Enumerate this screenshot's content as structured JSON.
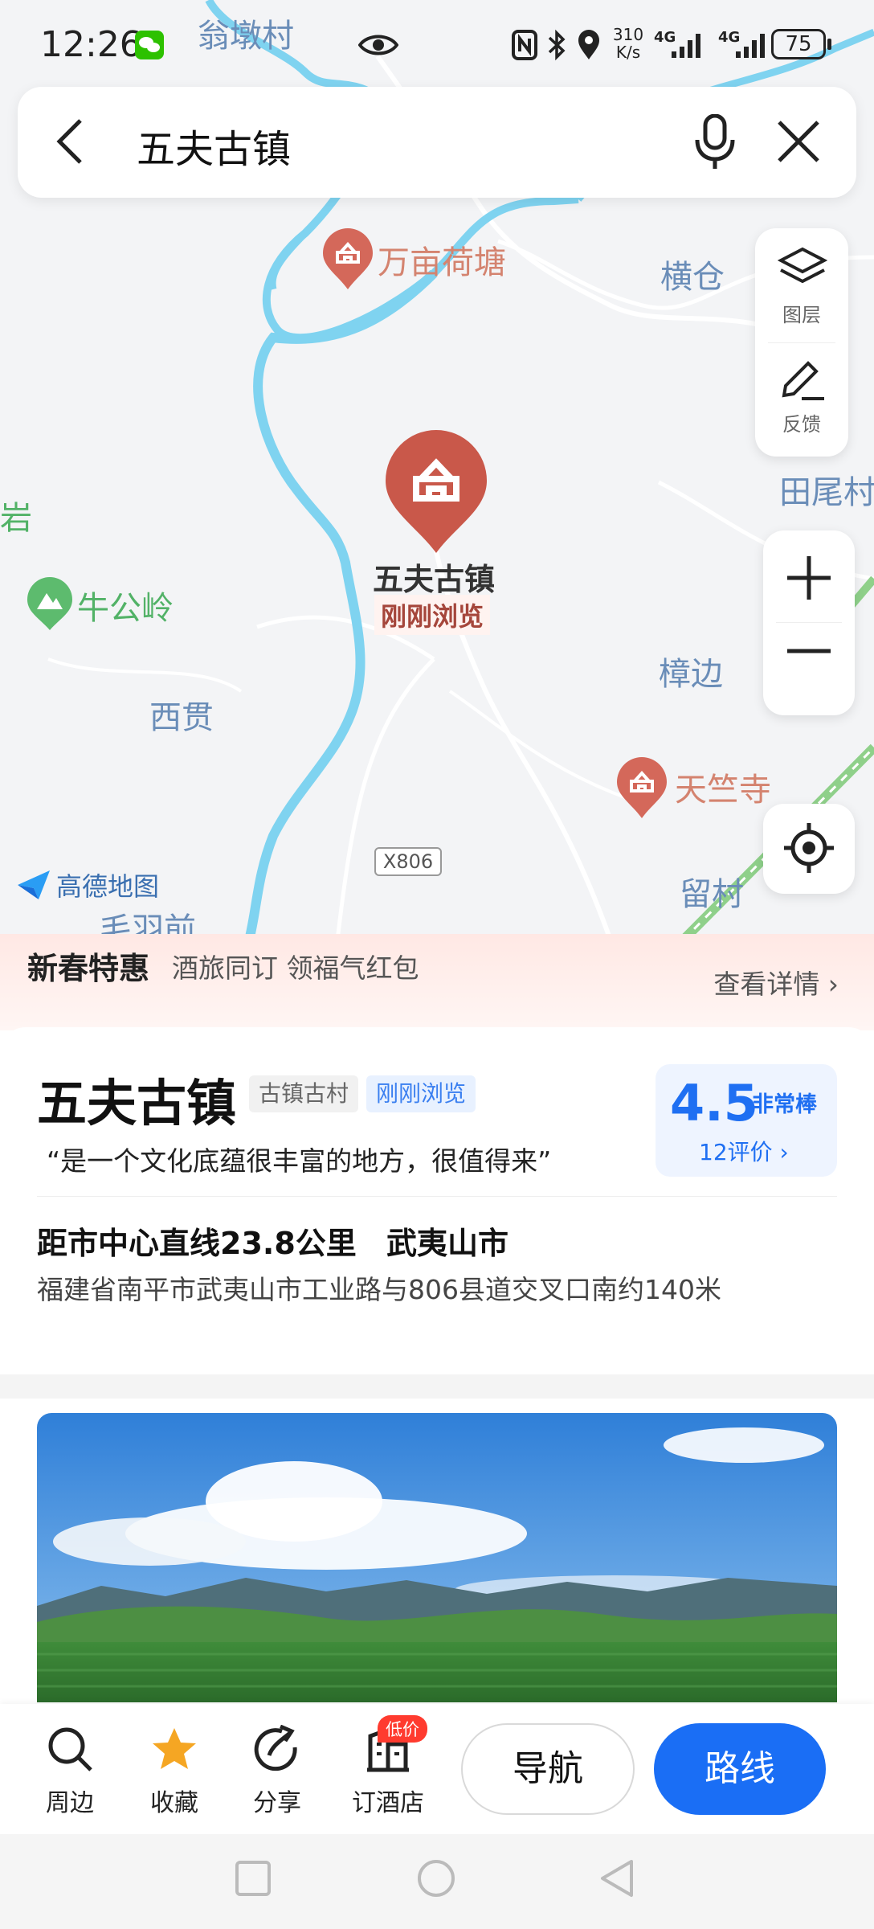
{
  "status_bar": {
    "time": "12:26",
    "net_speed_top": "310",
    "net_speed_bottom": "K/s",
    "network_1": "4G",
    "network_2": "4G",
    "battery": "75"
  },
  "search": {
    "query": "五夫古镇"
  },
  "map": {
    "labels": {
      "wengdun": "翁墩村",
      "wanmu": "万亩荷塘",
      "hengcang": "横仓",
      "tianwei": "田尾村",
      "yan": "岩",
      "niugongling": "牛公岭",
      "zhangbian": "樟边",
      "xigui": "西贯",
      "tianzhu": "天竺寺",
      "road": "X806",
      "liucun": "留村",
      "maoyu": "毛羽前"
    },
    "selected_poi": {
      "name": "五夫古镇",
      "badge": "刚刚浏览"
    },
    "logo": "高德地图",
    "controls": {
      "layers": "图层",
      "feedback": "反馈"
    }
  },
  "promo": {
    "title": "新春特惠",
    "subtitle": "酒旅同订 领福气红包",
    "more": "查看详情 ›"
  },
  "place": {
    "name": "五夫古镇",
    "tag_category": "古镇古村",
    "tag_recent": "刚刚浏览",
    "quote": "“是一个文化底蕴很丰富的地方，很值得来”",
    "score": "4.5",
    "score_level": "非常棒",
    "review_count": "12评价 ›",
    "distance": "距市中心直线23.8公里",
    "city": "武夷山市",
    "address": "福建省南平市武夷山市工业路与806县道交叉口南约140米"
  },
  "bottom_bar": {
    "nearby": "周边",
    "favorite": "收藏",
    "share": "分享",
    "hotel": "订酒店",
    "hotel_badge": "低价",
    "navigate": "导航",
    "route": "路线"
  },
  "colors": {
    "accent_blue": "#1a6ef5",
    "poi_red": "#c9584a",
    "river": "#7fd3f0"
  }
}
